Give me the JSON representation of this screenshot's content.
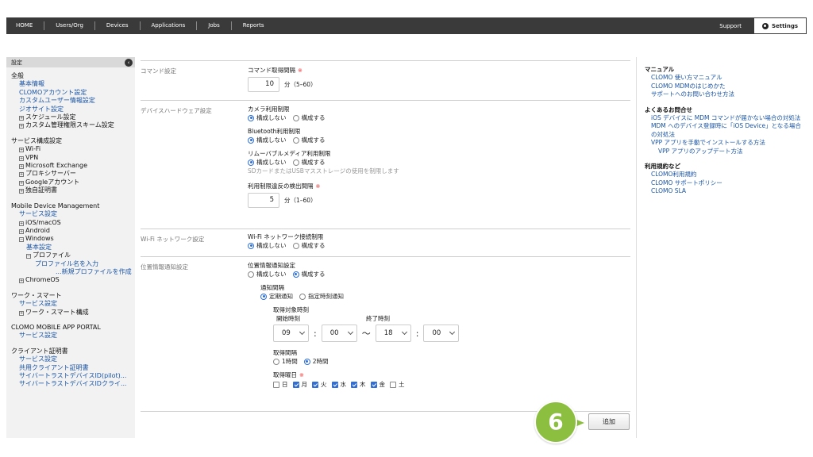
{
  "nav": {
    "items": [
      "HOME",
      "Users/Org",
      "Devices",
      "Applications",
      "Jobs",
      "Reports"
    ],
    "support": "Support",
    "settings": "Settings"
  },
  "sidebar": {
    "header": "設定",
    "collapse_symbol": "‹",
    "sections": [
      {
        "title": "全般",
        "items": [
          {
            "label": "基本情報",
            "kind": "link",
            "level": 1
          },
          {
            "label": "CLOMOアカウント設定",
            "kind": "link",
            "level": 1
          },
          {
            "label": "カスタムユーザー情報設定",
            "kind": "link",
            "level": 1
          },
          {
            "label": "ジオサイト設定",
            "kind": "link",
            "level": 1
          },
          {
            "label": "スケジュール設定",
            "kind": "exp",
            "level": 1
          },
          {
            "label": "カスタム管理権限スキーム設定",
            "kind": "exp",
            "level": 1
          }
        ]
      },
      {
        "title": "サービス構成設定",
        "items": [
          {
            "label": "Wi-Fi",
            "kind": "exp",
            "level": 1
          },
          {
            "label": "VPN",
            "kind": "exp",
            "level": 1
          },
          {
            "label": "Microsoft Exchange",
            "kind": "exp",
            "level": 1
          },
          {
            "label": "プロキシサーバー",
            "kind": "exp",
            "level": 1
          },
          {
            "label": "Googleアカウント",
            "kind": "exp",
            "level": 1
          },
          {
            "label": "独自証明書",
            "kind": "exp",
            "level": 1
          }
        ]
      },
      {
        "title": "Mobile Device Management",
        "items": [
          {
            "label": "サービス設定",
            "kind": "link",
            "level": 1
          },
          {
            "label": "iOS/macOS",
            "kind": "exp",
            "level": 1
          },
          {
            "label": "Android",
            "kind": "exp",
            "level": 1
          },
          {
            "label": "Windows",
            "kind": "col",
            "level": 1
          },
          {
            "label": "基本設定",
            "kind": "link",
            "level": 2
          },
          {
            "label": "プロファイル",
            "kind": "col",
            "level": 2
          },
          {
            "label": "プロファイル名を入力",
            "kind": "link",
            "level": 3
          },
          {
            "label": "...新規プロファイルを作成",
            "kind": "link",
            "level": 4
          },
          {
            "label": "ChromeOS",
            "kind": "exp",
            "level": 1
          }
        ]
      },
      {
        "title": "ワーク・スマート",
        "items": [
          {
            "label": "サービス設定",
            "kind": "link",
            "level": 1
          },
          {
            "label": "ワーク・スマート構成",
            "kind": "exp",
            "level": 1
          }
        ]
      },
      {
        "title": "CLOMO MOBILE APP PORTAL",
        "items": [
          {
            "label": "サービス設定",
            "kind": "link",
            "level": 1
          }
        ]
      },
      {
        "title": "クライアント証明書",
        "items": [
          {
            "label": "サービス設定",
            "kind": "link",
            "level": 1
          },
          {
            "label": "共用クライアント証明書",
            "kind": "link",
            "level": 1
          },
          {
            "label": "サイバートラストデバイスID(pilot)...",
            "kind": "link",
            "level": 1
          },
          {
            "label": "サイバートラストデバイスIDクライ...",
            "kind": "link",
            "level": 1
          }
        ]
      }
    ]
  },
  "form": {
    "command": {
      "section": "コマンド設定",
      "interval_label": "コマンド取得間隔",
      "required_mark": "※",
      "interval_value": "10",
      "interval_unit": "分（5–60）"
    },
    "hardware": {
      "section": "デバイスハードウェア設定",
      "camera_label": "カメラ利用制限",
      "bluetooth_label": "Bluetooth利用制限",
      "removable_label": "リムーバブルメディア利用制限",
      "removable_hint": "SDカードまたはUSBマスストレージの使用を制限します",
      "violation_label": "利用制限違反の検出間隔",
      "violation_value": "5",
      "violation_unit": "分（1–60）",
      "opt_off": "構成しない",
      "opt_on": "構成する"
    },
    "wifi": {
      "section": "Wi-Fi ネットワーク設定",
      "conn_label": "Wi-Fi ネットワーク接続制限"
    },
    "location": {
      "section": "位置情報通知設定",
      "notify_label": "位置情報通知設定",
      "interval_label": "通知間隔",
      "periodic": "定期通知",
      "specified": "指定時刻通知",
      "target_time_label": "取得対象時刻",
      "start_label": "開始時刻",
      "end_label": "終了時刻",
      "start_hour": "09",
      "start_min": "00",
      "end_hour": "18",
      "end_min": "00",
      "colon": ":",
      "tilde": "〜",
      "acq_interval_label": "取得間隔",
      "one_hour": "1時間",
      "two_hour": "2時間",
      "days_label": "取得曜日",
      "days": [
        {
          "label": "日",
          "checked": false
        },
        {
          "label": "月",
          "checked": true
        },
        {
          "label": "火",
          "checked": true
        },
        {
          "label": "水",
          "checked": true
        },
        {
          "label": "木",
          "checked": true
        },
        {
          "label": "金",
          "checked": true
        },
        {
          "label": "土",
          "checked": false
        }
      ]
    },
    "add_button": "追加",
    "step_number": "6"
  },
  "help": {
    "groups": [
      {
        "title": "マニュアル",
        "links": [
          {
            "label": "CLOMO 使い方マニュアル",
            "indent": false
          },
          {
            "label": "CLOMO MDMのはじめかた",
            "indent": false
          },
          {
            "label": "サポートへのお問い合わせ方法",
            "indent": false
          }
        ]
      },
      {
        "title": "よくあるお問合せ",
        "links": [
          {
            "label": "iOS デバイスに MDM コマンドが届かない場合の対処法",
            "indent": false
          },
          {
            "label": "MDM へのデバイス登録時に「iOS Device」となる場合の対処法",
            "indent": false
          },
          {
            "label": "VPP アプリを手動でインストールする方法",
            "indent": false
          },
          {
            "label": "VPP アプリのアップデート方法",
            "indent": true
          }
        ]
      },
      {
        "title": "利用規約など",
        "links": [
          {
            "label": "CLOMO利用規約",
            "indent": false
          },
          {
            "label": "CLOMO サポートポリシー",
            "indent": false
          },
          {
            "label": "CLOMO SLA",
            "indent": false
          }
        ]
      }
    ]
  }
}
